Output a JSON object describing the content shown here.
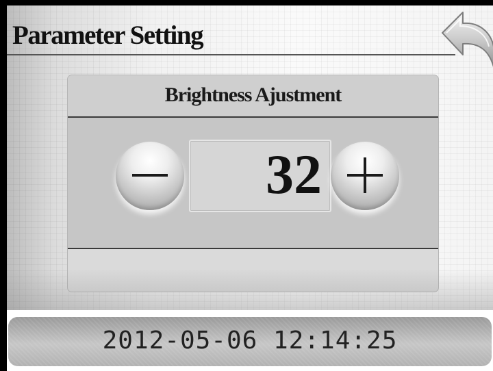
{
  "header": {
    "title": "Parameter Setting",
    "back_icon": "back-arrow-icon"
  },
  "dialog": {
    "title": "Brightness Ajustment",
    "value": "32",
    "decrement_icon": "minus-icon",
    "increment_icon": "plus-icon"
  },
  "status": {
    "datetime": "2012-05-06 12:14:25"
  },
  "colors": {
    "panel": "#c9c9c9",
    "text": "#111111",
    "datetime_bar": "#b2b2b2"
  }
}
